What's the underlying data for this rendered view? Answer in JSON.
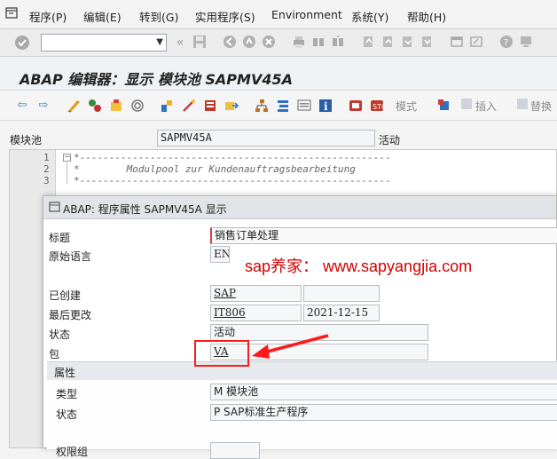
{
  "menu": {
    "icon": "menu-icon",
    "items": [
      "程序(P)",
      "编辑(E)",
      "转到(G)",
      "实用程序(S)",
      "Environment",
      "系统(Y)",
      "帮助(H)"
    ]
  },
  "title": "ABAP 编辑器：显示 模块池 SAPMV45A",
  "toolbar": {
    "pattern_label": "模式",
    "insert_label": "插入",
    "replace_label": "替换"
  },
  "module_pool": {
    "label": "模块池",
    "value": "SAPMV45A",
    "status": "活动"
  },
  "editor": {
    "lines": [
      {
        "num": "1",
        "text": "*-----------------------------------------------------"
      },
      {
        "num": "2",
        "text": "*        Modulpool zur Kundenauftragsbearbeitung"
      },
      {
        "num": "3",
        "text": "*-----------------------------------------------------"
      }
    ]
  },
  "popup": {
    "title": "ABAP: 程序属性 SAPMV45A 显示",
    "fields": {
      "title_label": "标题",
      "title_value": "销售订单处理",
      "orig_lang_label": "原始语言",
      "orig_lang_value": "EN",
      "created_label": "已创建",
      "created_by": "SAP",
      "created_date": "",
      "changed_label": "最后更改",
      "changed_by": "IT806",
      "changed_date": "2021-12-15",
      "status_label": "状态",
      "status_value": "活动",
      "package_label": "包",
      "package_value": "VA"
    },
    "attributes": {
      "header": "属性",
      "type_label": "类型",
      "type_value": "M 模块池",
      "status_label": "状态",
      "status_value": "P SAP标准生产程序",
      "auth_group_label": "权限组"
    }
  },
  "watermark": "sap养家： www.sapyangjia.com",
  "colors": {
    "annotation_red": "#ff1a1a",
    "watermark_red": "#d20000"
  }
}
